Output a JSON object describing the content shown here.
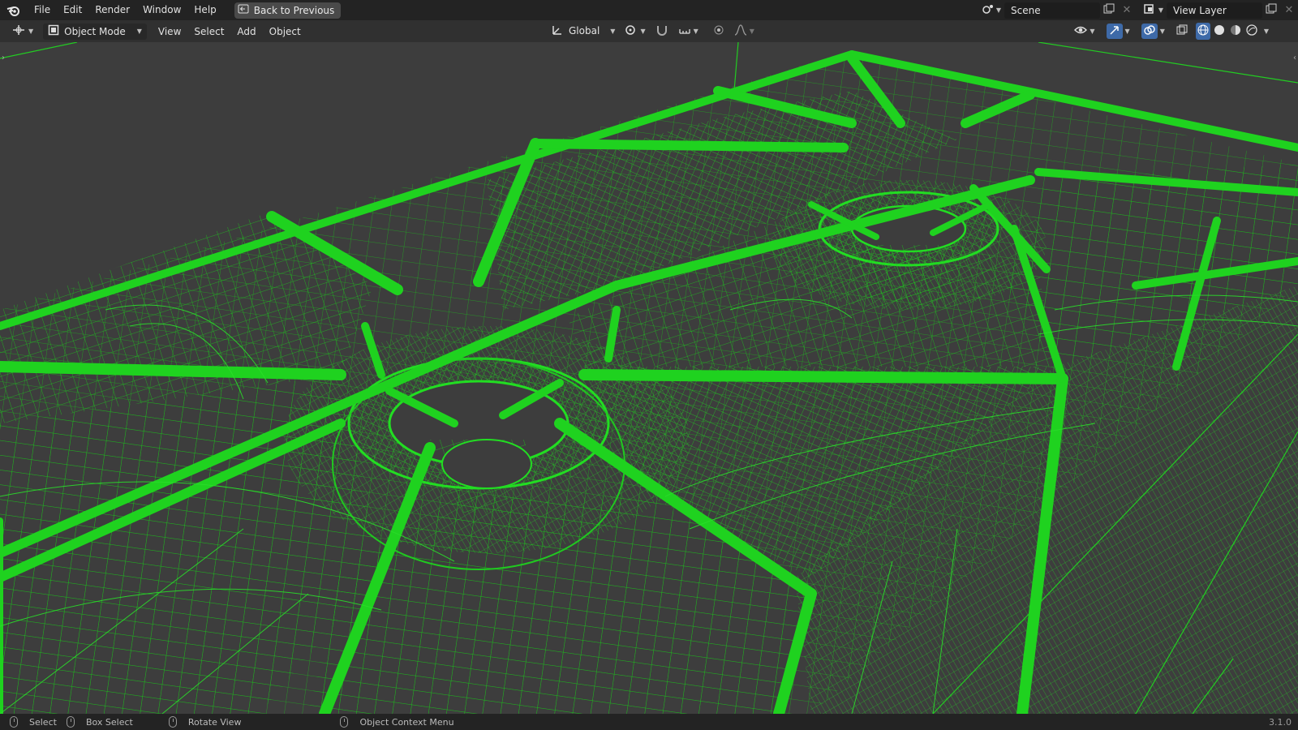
{
  "topbar": {
    "menus": [
      "File",
      "Edit",
      "Render",
      "Window",
      "Help"
    ],
    "back_button": "Back to Previous",
    "scene_name": "Scene",
    "view_layer_name": "View Layer"
  },
  "header": {
    "mode": "Object Mode",
    "menus": [
      "View",
      "Select",
      "Add",
      "Object"
    ],
    "transform_orientation": "Global"
  },
  "statusbar": {
    "select": "Select",
    "box_select": "Box Select",
    "rotate_view": "Rotate View",
    "context_menu": "Object Context Menu",
    "version": "3.1.0"
  },
  "colors": {
    "wire": "#1fd21f",
    "viewport_bg": "#3d3d3d",
    "topbar_bg": "#232323",
    "header_bg": "#303030"
  },
  "icons": [
    "blender-logo-icon",
    "back-icon",
    "scene-icon",
    "view-layer-icon",
    "new-icon",
    "close-icon",
    "editor-type-icon",
    "object-mode-icon",
    "orientation-icon",
    "pivot-icon",
    "snap-icon",
    "snap-increment-icon",
    "proportional-icon",
    "falloff-icon",
    "visibility-icon",
    "gizmo-icon",
    "overlay-icon",
    "xray-icon",
    "wireframe-shading-icon",
    "solid-shading-icon",
    "material-shading-icon",
    "rendered-shading-icon",
    "mouse-icon"
  ]
}
